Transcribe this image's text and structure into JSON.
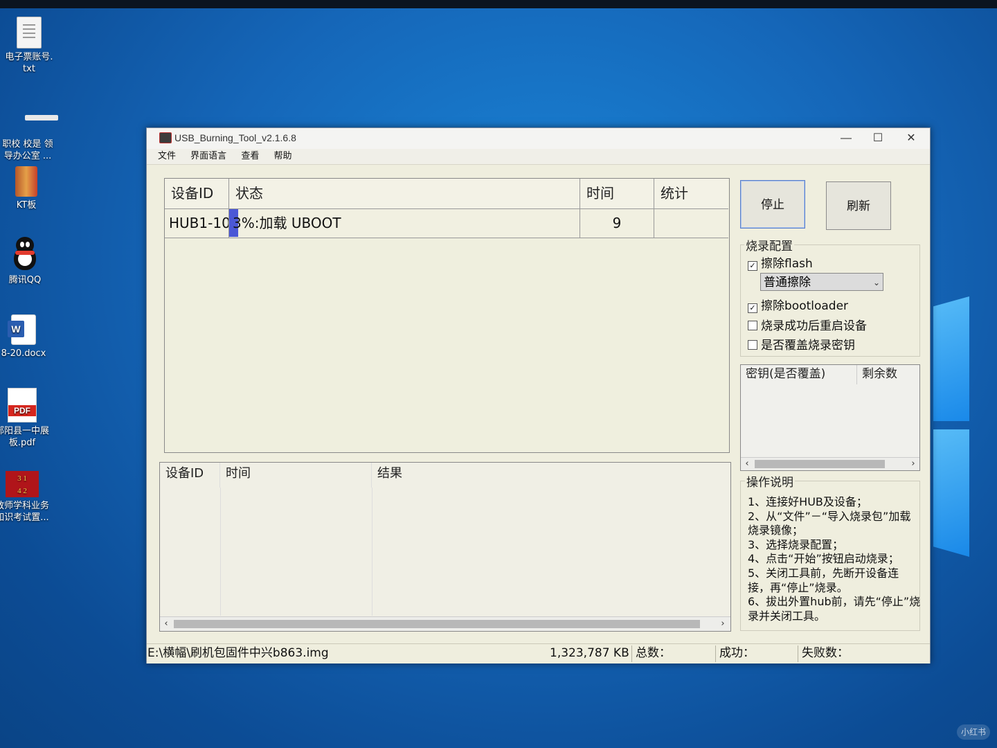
{
  "desktop": {
    "icons": [
      {
        "label": "电子票账号.\ntxt"
      },
      {
        "label": "职校 校是 领\n导办公室 ..."
      },
      {
        "label": "KT板"
      },
      {
        "label": "腾讯QQ"
      },
      {
        "label": "8-20.docx"
      },
      {
        "label": "部阳县一中展\n板.pdf"
      },
      {
        "label": "教师学科业务\n知识考试置..."
      }
    ]
  },
  "window": {
    "title": "USB_Burning_Tool_v2.1.6.8",
    "controls": {
      "minimize": "—",
      "maximize": "☐",
      "close": "✕"
    },
    "menu": [
      "文件",
      "界面语言",
      "查看",
      "帮助"
    ]
  },
  "device_table": {
    "headers": [
      "设备ID",
      "状态",
      "时间",
      "统计"
    ],
    "rows": [
      {
        "device_id": "HUB1-10",
        "status": "3%:加载 UBOOT",
        "time": "9",
        "stat": ""
      }
    ],
    "progress_percent": 3
  },
  "buttons": {
    "stop": "停止",
    "refresh": "刷新"
  },
  "burn_config": {
    "title": "烧录配置",
    "erase_flash": {
      "label": "擦除flash",
      "checked": true
    },
    "erase_mode": {
      "value": "普通擦除"
    },
    "erase_bootloader": {
      "label": "擦除bootloader",
      "checked": true
    },
    "reboot_after": {
      "label": "烧录成功后重启设备",
      "checked": false
    },
    "overwrite_key": {
      "label": "是否覆盖烧录密钥",
      "checked": false
    }
  },
  "key_table": {
    "headers": [
      "密钥(是否覆盖)",
      "剩余数"
    ]
  },
  "log_table": {
    "headers": [
      "设备ID",
      "时间",
      "结果"
    ]
  },
  "instructions": {
    "title": "操作说明",
    "lines": [
      "1、连接好HUB及设备；",
      "2、从“文件”－“导入烧录包”加载烧录镜像；",
      "3、选择烧录配置；",
      "4、点击“开始”按钮启动烧录；",
      "5、关闭工具前，先断开设备连接，再“停止”烧录。",
      "6、拔出外置hub前，请先“停止”烧录并关闭工具。"
    ]
  },
  "statusbar": {
    "path": "E:\\横幅\\刷机包固件中兴b863.img",
    "size": "1,323,787 KB",
    "total": "总数：",
    "success": "成功：",
    "failed": "失败数："
  },
  "watermark": "小红书",
  "colors": {
    "progress": "#4b58d6",
    "window_bg": "#efeede",
    "desktop": "#1566b8"
  }
}
